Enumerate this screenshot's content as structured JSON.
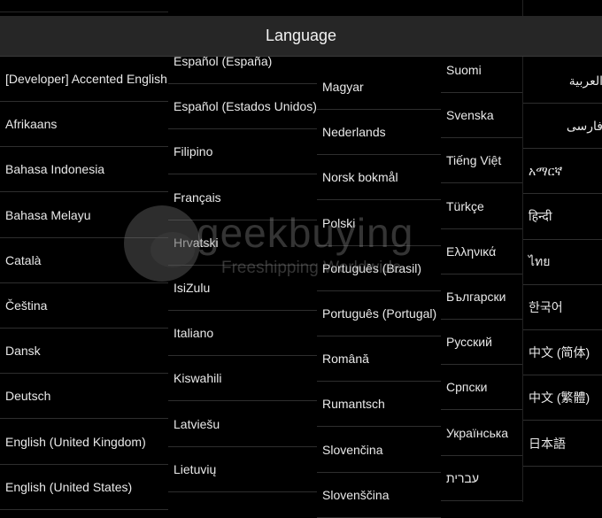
{
  "header": {
    "title": "Language"
  },
  "watermark": {
    "brand": "geekbuying",
    "tagline": "Freeshipping Worldwide"
  },
  "columns": [
    [
      "[Developer] Accented English",
      "Afrikaans",
      "Bahasa Indonesia",
      "Bahasa Melayu",
      "Català",
      "Čeština",
      "Dansk",
      "Deutsch",
      "English (United Kingdom)",
      "English (United States)"
    ],
    [
      "Español (España)",
      "Español (Estados Unidos)",
      "Filipino",
      "Français",
      "Hrvatski",
      "IsiZulu",
      "Italiano",
      "Kiswahili",
      "Latviešu",
      "Lietuvių"
    ],
    [
      "Magyar",
      "Nederlands",
      "Norsk bokmål",
      "Polski",
      "Português (Brasil)",
      "Português (Portugal)",
      "Română",
      "Rumantsch",
      "Slovenčina",
      "Slovenščina"
    ],
    [
      "Suomi",
      "Svenska",
      "Tiếng Việt",
      "Türkçe",
      "Ελληνικά",
      "Български",
      "Русский",
      "Српски",
      "Українська",
      "עברית"
    ],
    [
      "العربية",
      "فارسی",
      "አማርኛ",
      "हिन्दी",
      "ไทย",
      "한국어",
      "中文 (简体)",
      "中文 (繁體)",
      "日本語"
    ]
  ]
}
